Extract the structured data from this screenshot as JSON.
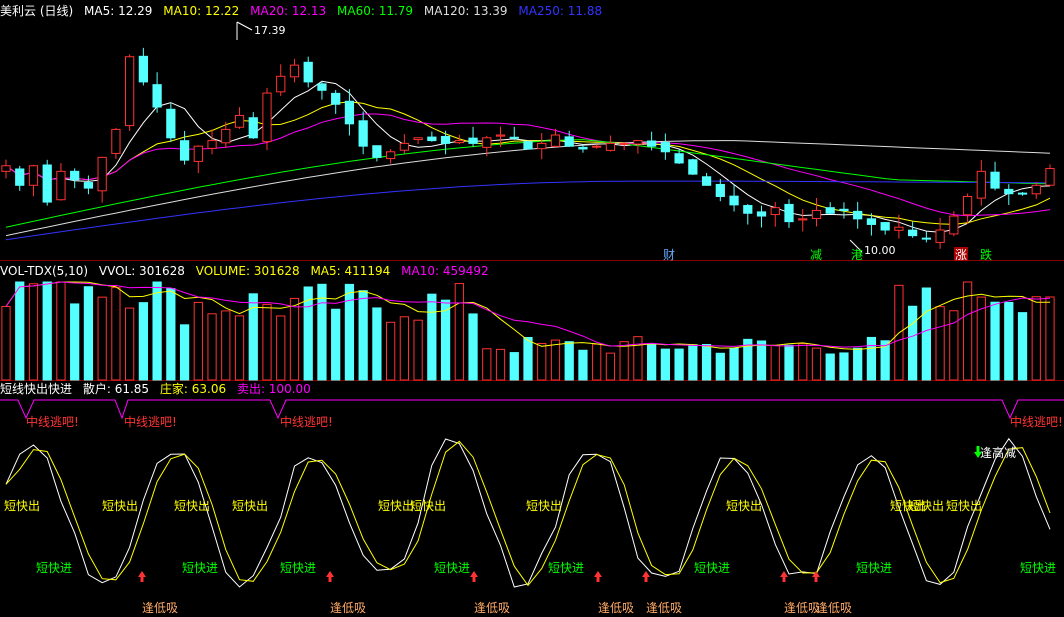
{
  "main_panel": {
    "title": "美利云 (日线)",
    "indicators": [
      {
        "label": "MA5: 12.29",
        "color": "#ffffff"
      },
      {
        "label": "MA10: 12.22",
        "color": "#ffff00"
      },
      {
        "label": "MA20: 12.13",
        "color": "#ff00ff"
      },
      {
        "label": "MA60: 11.79",
        "color": "#00ff00"
      },
      {
        "label": "MA120: 13.39",
        "color": "#dddddd"
      },
      {
        "label": "MA250: 11.88",
        "color": "#3333ff"
      }
    ],
    "high_marker": "17.39",
    "low_marker": "10.00",
    "event_tags": [
      {
        "text": "财",
        "color": "#66aaff"
      },
      {
        "text": "减",
        "color": "#00ff00"
      },
      {
        "text": "港",
        "color": "#00ff00"
      },
      {
        "text": "涨",
        "color": "#ff3333"
      },
      {
        "text": "跌",
        "color": "#00ff00"
      }
    ]
  },
  "volume_panel": {
    "indicators": [
      {
        "label": "VOL-TDX(5,10)",
        "color": "#ffffff"
      },
      {
        "label": "VVOL: 301628",
        "color": "#ffffff"
      },
      {
        "label": "VOLUME: 301628",
        "color": "#ffff00"
      },
      {
        "label": "MA5: 411194",
        "color": "#ffff00"
      },
      {
        "label": "MA10: 459492",
        "color": "#ff00ff"
      }
    ]
  },
  "signal_panel": {
    "indicators": [
      {
        "label": "短线快出快进",
        "color": "#ffffff"
      },
      {
        "label": "散户: 61.85",
        "color": "#ffffff"
      },
      {
        "label": "庄家: 63.06",
        "color": "#ffff00"
      },
      {
        "label": "卖出: 100.00",
        "color": "#ff00ff"
      }
    ],
    "exit_label": "中线逃吧!",
    "sell_label": "短快出",
    "buy_label": "短快进",
    "low_buy_label": "逢低吸",
    "high_reduce_label": "逢高减"
  },
  "colors": {
    "up": "#ff3232",
    "down": "#54ffff",
    "bg": "#000000",
    "grid": "#8b0000"
  },
  "chart_data": {
    "type": "candlestick",
    "close": [
      12.6,
      11.9,
      12.6,
      11.3,
      12.4,
      12.1,
      11.8,
      12.9,
      13.9,
      16.5,
      15.6,
      14.7,
      13.6,
      12.8,
      13.3,
      13.5,
      13.9,
      14.4,
      13.6,
      15.2,
      15.8,
      16.2,
      15.6,
      15.3,
      14.8,
      14.1,
      13.3,
      12.9,
      13.1,
      13.4,
      13.6,
      13.5,
      13.4,
      13.5,
      13.4,
      13.6,
      13.7,
      13.6,
      13.2,
      13.4,
      13.7,
      13.3,
      13.2,
      13.3,
      13.4,
      13.4,
      13.5,
      13.3,
      13.1,
      12.7,
      12.3,
      11.9,
      11.5,
      11.2,
      10.9,
      10.8,
      11.1,
      10.6,
      10.7,
      11.0,
      10.9,
      11.0,
      10.7,
      10.5,
      10.3,
      10.4,
      10.1,
      10.0,
      10.3,
      10.8,
      11.5,
      12.4,
      11.8,
      11.6,
      11.6,
      11.9,
      12.5
    ]
  }
}
